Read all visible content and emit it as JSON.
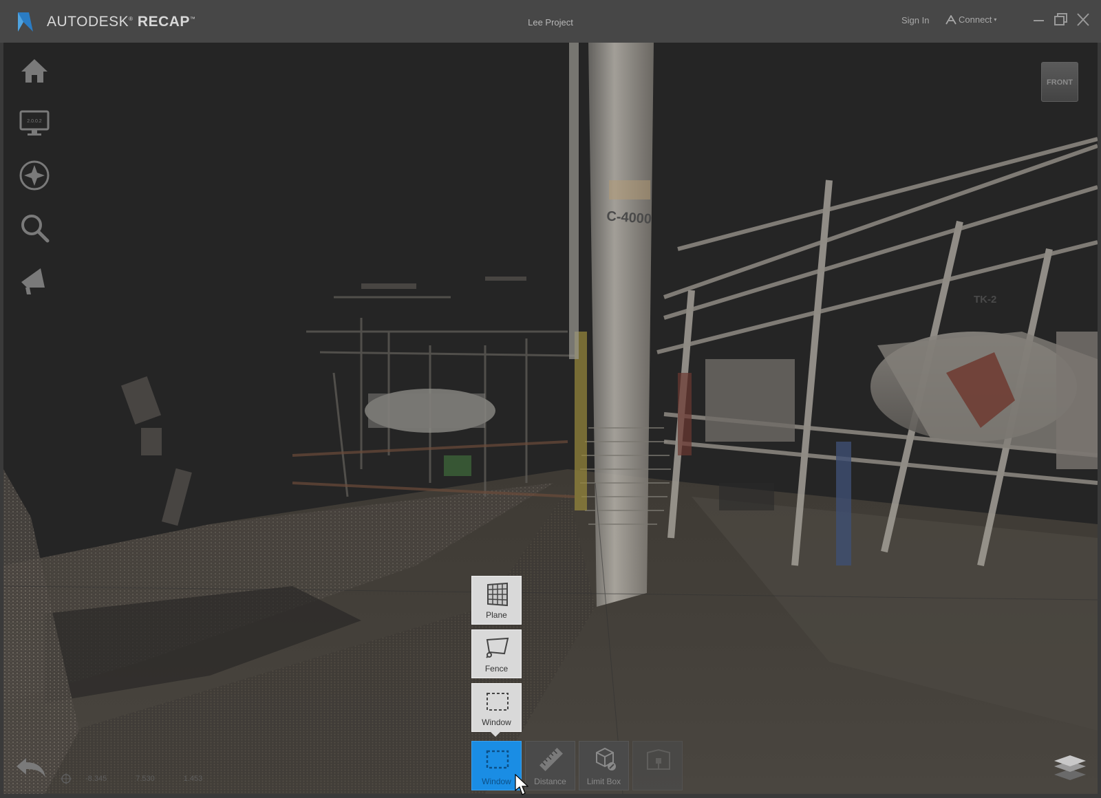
{
  "app": {
    "brand_prefix": "AUTODESK",
    "brand_name": "RECAP",
    "project_title": "Lee Project"
  },
  "header": {
    "sign_in": "Sign In",
    "connect": "Connect"
  },
  "left_nav": {
    "items": [
      {
        "name": "home",
        "icon": "home-icon"
      },
      {
        "name": "display-settings",
        "icon": "monitor-icon",
        "badge": "2.0.0.2"
      },
      {
        "name": "navigation",
        "icon": "compass-icon"
      },
      {
        "name": "search",
        "icon": "search-icon"
      },
      {
        "name": "annotate",
        "icon": "megaphone-icon"
      }
    ]
  },
  "viewcube": {
    "label": "FRONT"
  },
  "scene": {
    "tag_column": "C-4000",
    "tag_tank": "TK-2"
  },
  "popup_menu": {
    "items": [
      {
        "label": "Plane",
        "icon": "grid-plane-icon"
      },
      {
        "label": "Fence",
        "icon": "fence-icon"
      },
      {
        "label": "Window",
        "icon": "window-select-icon"
      }
    ]
  },
  "toolbar": {
    "items": [
      {
        "label": "Window",
        "icon": "window-select-icon",
        "state": "active"
      },
      {
        "label": "Distance",
        "icon": "ruler-icon",
        "state": "normal"
      },
      {
        "label": "Limit Box",
        "icon": "limit-box-icon",
        "state": "normal"
      },
      {
        "label": "",
        "icon": "scan-location-icon",
        "state": "disabled"
      }
    ]
  },
  "status": {
    "x": "-8.345",
    "y": "7.530",
    "z": "1.453"
  },
  "colors": {
    "accent": "#1a8de4",
    "titlebar": "#474747",
    "viewport_bg": "#252525"
  }
}
